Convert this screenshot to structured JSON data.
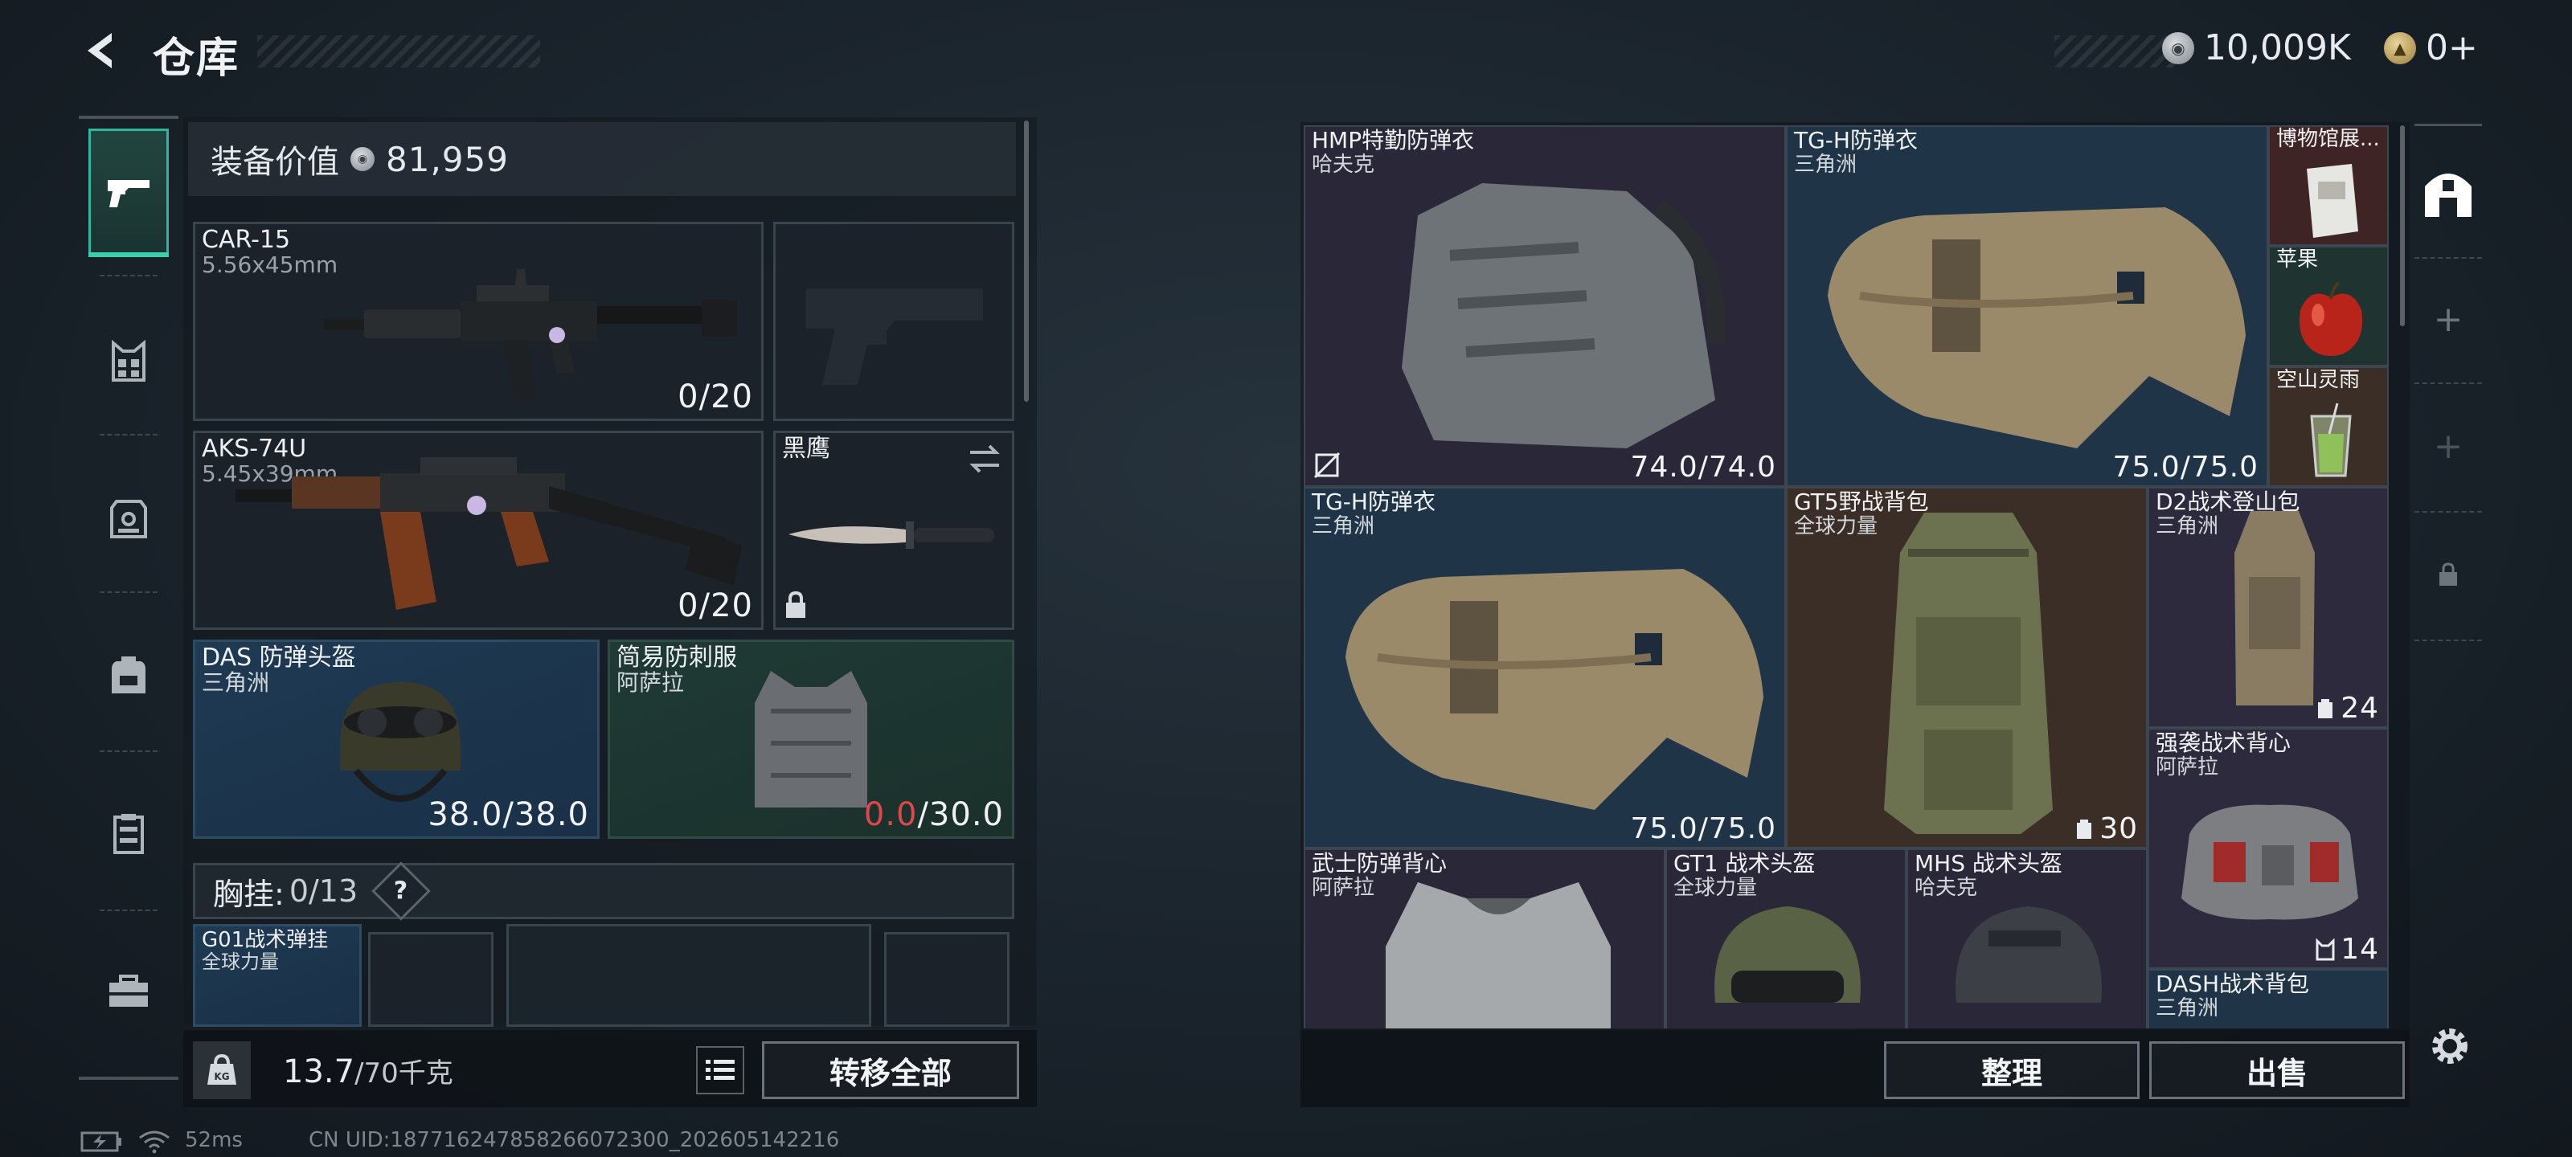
{
  "header": {
    "title": "仓库",
    "currency_silver": "10,009K",
    "currency_gold": "0+"
  },
  "loadout": {
    "value_label": "装备价值",
    "value": "81,959",
    "primary1": {
      "name": "CAR-15",
      "caliber": "5.56x45mm",
      "ammo": "0/20"
    },
    "primary2": {
      "name": "AKS-74U",
      "caliber": "5.45x39mm",
      "ammo": "0/20"
    },
    "melee": {
      "name": "黑鹰"
    },
    "helmet": {
      "name": "DAS 防弹头盔",
      "maker": "三角洲",
      "durability": "38.0/38.0"
    },
    "armor": {
      "name": "简易防刺服",
      "maker": "阿萨拉",
      "dur_current": "0.0",
      "dur_max": "/30.0"
    },
    "chest_rig": {
      "label": "胸挂:",
      "count": "0/13",
      "help": "?"
    },
    "rig_slot": {
      "name": "G01战术弹挂",
      "maker": "全球力量"
    }
  },
  "capacity": {
    "current": "13.7",
    "max": "/70千克"
  },
  "buttons": {
    "transfer_all": "转移全部",
    "organize": "整理",
    "sell": "出售"
  },
  "status": {
    "ping": "52ms",
    "uid": "CN UID:1877162478582660723​00_202605142216"
  },
  "storage": [
    {
      "name": "HMP特勤防弹衣",
      "maker": "哈夫克",
      "value": "74.0/74.0"
    },
    {
      "name": "TG-H防弹衣",
      "maker": "三角洲",
      "value": "75.0/75.0"
    },
    {
      "name": "博物馆展...",
      "maker": ""
    },
    {
      "name": "苹果",
      "maker": ""
    },
    {
      "name": "空山灵雨",
      "maker": ""
    },
    {
      "name": "TG-H防弹衣",
      "maker": "三角洲",
      "value": "75.0/75.0"
    },
    {
      "name": "GT5野战背包",
      "maker": "全球力量",
      "value": "30"
    },
    {
      "name": "D2战术登山包",
      "maker": "三角洲",
      "value": "24"
    },
    {
      "name": "强袭战术背心",
      "maker": "阿萨拉",
      "value": "14"
    },
    {
      "name": "武士防弹背心",
      "maker": "阿萨拉"
    },
    {
      "name": "GT1 战术头盔",
      "maker": "全球力量"
    },
    {
      "name": "MHS 战术头盔",
      "maker": "哈夫克"
    },
    {
      "name": "DASH战术背包",
      "maker": "三角洲"
    }
  ],
  "colors": {
    "accent": "#39d1ad",
    "danger": "#e0474a"
  }
}
